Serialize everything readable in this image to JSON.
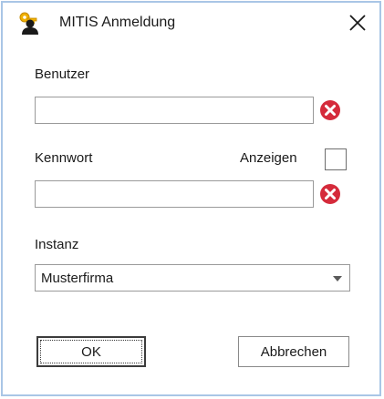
{
  "window": {
    "title": "MITIS Anmeldung",
    "close_label": "×"
  },
  "user": {
    "label": "Benutzer",
    "value": ""
  },
  "password": {
    "label": "Kennwort",
    "value": "",
    "show_label": "Anzeigen",
    "show_checked": false
  },
  "instance": {
    "label": "Instanz",
    "selected": "Musterfirma"
  },
  "buttons": {
    "ok_label": "OK",
    "cancel_label": "Abbrechen"
  },
  "colors": {
    "clear_icon": "#d52b3b",
    "window_border": "#a9c6e6",
    "icon_key": "#f0b000"
  },
  "icons": {
    "app": "user-key-icon",
    "close": "close-icon",
    "clear": "clear-icon",
    "dropdown": "chevron-down-icon"
  }
}
